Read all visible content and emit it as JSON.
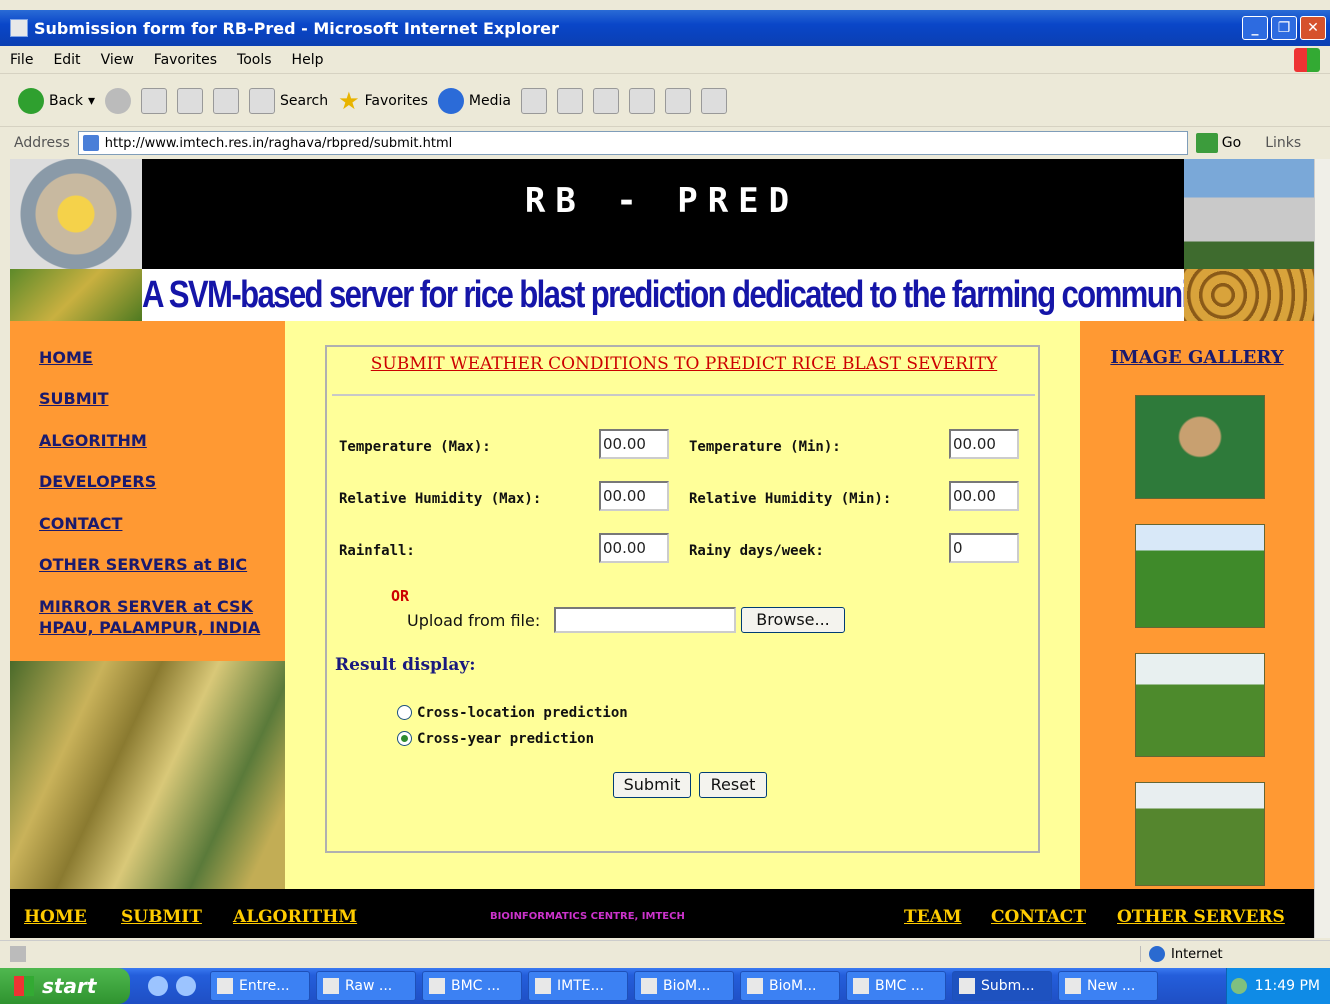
{
  "window": {
    "title": "Submission form for RB-Pred - Microsoft Internet Explorer"
  },
  "menu": [
    "File",
    "Edit",
    "View",
    "Favorites",
    "Tools",
    "Help"
  ],
  "toolbar": {
    "back": "Back",
    "search": "Search",
    "favorites": "Favorites",
    "media": "Media"
  },
  "address": {
    "label": "Address",
    "url": "http://www.imtech.res.in/raghava/rbpred/submit.html",
    "go": "Go",
    "links": "Links"
  },
  "header": {
    "title": "RB - PRED",
    "banner": "A SVM-based server for rice blast prediction dedicated to the farming community"
  },
  "leftnav": [
    "HOME",
    "SUBMIT",
    "ALGORITHM",
    "DEVELOPERS",
    "CONTACT",
    "OTHER SERVERS at BIC",
    "MIRROR SERVER at CSK",
    "HPAU, PALAMPUR, INDIA"
  ],
  "gallery": {
    "title": "IMAGE GALLERY"
  },
  "form": {
    "title": "SUBMIT WEATHER CONDITIONS TO PREDICT RICE BLAST SEVERITY",
    "fields": {
      "temp_max": {
        "label": "Temperature (Max):",
        "value": "00.00"
      },
      "temp_min": {
        "label": "Temperature (Min):",
        "value": "00.00"
      },
      "rh_max": {
        "label": "Relative Humidity (Max):",
        "value": "00.00"
      },
      "rh_min": {
        "label": "Relative Humidity (Min):",
        "value": "00.00"
      },
      "rainfall": {
        "label": "Rainfall:",
        "value": "00.00"
      },
      "rainy_days": {
        "label": "Rainy days/week:",
        "value": "0"
      }
    },
    "or": "OR",
    "upload_label": "Upload from file:",
    "browse": "Browse...",
    "result_label": "Result display:",
    "options": [
      {
        "label": "Cross-location prediction",
        "selected": false
      },
      {
        "label": "Cross-year prediction",
        "selected": true
      }
    ],
    "submit": "Submit",
    "reset": "Reset"
  },
  "footer": {
    "home": "HOME",
    "submit": "SUBMIT",
    "algorithm": "ALGORITHM",
    "bic": "BIOINFORMATICS CENTRE, IMTECH",
    "team": "TEAM",
    "contact": "CONTACT",
    "other": "OTHER SERVERS"
  },
  "status": {
    "zone": "Internet"
  },
  "taskbar": {
    "start": "start",
    "tasks": [
      "Entre...",
      "Raw ...",
      "BMC ...",
      "IMTE...",
      "BioM...",
      "BioM...",
      "BMC ...",
      "Subm...",
      "New ..."
    ],
    "clock": "11:49 PM"
  }
}
